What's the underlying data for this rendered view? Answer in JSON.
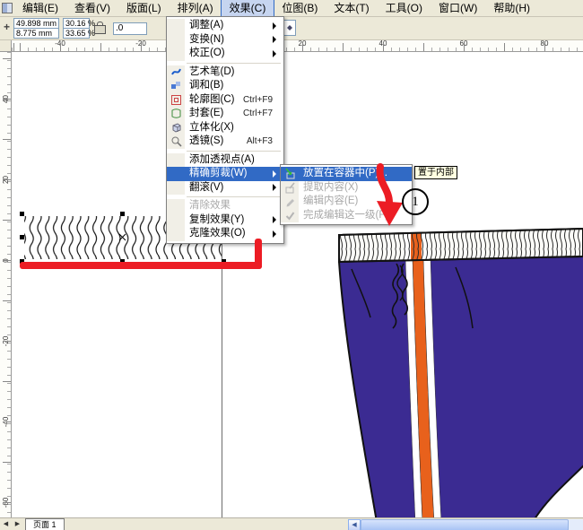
{
  "menubar": {
    "items": [
      {
        "label": "编辑(E)"
      },
      {
        "label": "查看(V)"
      },
      {
        "label": "版面(L)"
      },
      {
        "label": "排列(A)"
      },
      {
        "label": "效果(C)",
        "active": true
      },
      {
        "label": "位图(B)"
      },
      {
        "label": "文本(T)"
      },
      {
        "label": "工具(O)"
      },
      {
        "label": "窗口(W)"
      },
      {
        "label": "帮助(H)"
      }
    ]
  },
  "propertybar": {
    "x": "49.898 mm",
    "y": "8.775 mm",
    "scale_x": "30.16",
    "scale_y": "33.65",
    "percent_x": "%",
    "percent_y": "%",
    "rotation": ".0"
  },
  "effects_menu": {
    "items": [
      {
        "label": "调整(A)",
        "has_submenu": true
      },
      {
        "label": "变换(N)",
        "has_submenu": true
      },
      {
        "label": "校正(O)",
        "has_submenu": true
      },
      {
        "label": "艺术笔(D)",
        "icon": "artistic-media-icon"
      },
      {
        "label": "调和(B)",
        "icon": "blend-icon"
      },
      {
        "label": "轮廓图(C)",
        "shortcut": "Ctrl+F9",
        "icon": "contour-icon"
      },
      {
        "label": "封套(E)",
        "shortcut": "Ctrl+F7",
        "icon": "envelope-icon"
      },
      {
        "label": "立体化(X)",
        "icon": "extrude-icon"
      },
      {
        "label": "透镜(S)",
        "shortcut": "Alt+F3",
        "icon": "lens-icon"
      },
      {
        "label": "添加透视点(A)"
      },
      {
        "label": "精确剪裁(W)",
        "has_submenu": true,
        "highlighted": true
      },
      {
        "label": "翻滚(V)",
        "has_submenu": true
      },
      {
        "label": "清除效果",
        "disabled": true
      },
      {
        "label": "复制效果(Y)",
        "has_submenu": true
      },
      {
        "label": "克隆效果(O)",
        "has_submenu": true
      }
    ]
  },
  "powerclip_submenu": {
    "items": [
      {
        "label": "放置在容器中(P)...",
        "highlighted": true,
        "icon": "place-inside-container-icon"
      },
      {
        "label": "提取内容(X)",
        "disabled": true,
        "icon": "extract-contents-icon"
      },
      {
        "label": "编辑内容(E)",
        "disabled": true,
        "icon": "edit-contents-icon"
      },
      {
        "label": "完成编辑这一级(F)",
        "disabled": true,
        "icon": "finish-editing-icon"
      }
    ],
    "tooltip": "置于内部"
  },
  "annotations": {
    "step": "1"
  },
  "rulers": {
    "h": [
      "-40",
      "-20",
      "20",
      "40",
      "60",
      "80"
    ],
    "v": [
      "40",
      "20",
      "0",
      "-20",
      "-40",
      "-60"
    ]
  },
  "statusbar": {
    "page_tab": "页面 1"
  },
  "icons": {
    "prev_page": "◀",
    "next_page": "▶",
    "scroll_left": "◀",
    "object_position": "+"
  },
  "colors": {
    "menu_highlight": "#316ac5",
    "pants_purple": "#3b2b92",
    "stripe_orange": "#e8611c",
    "annotation_red": "#ec1c24",
    "tooltip_yellow": "#ffffe1"
  }
}
